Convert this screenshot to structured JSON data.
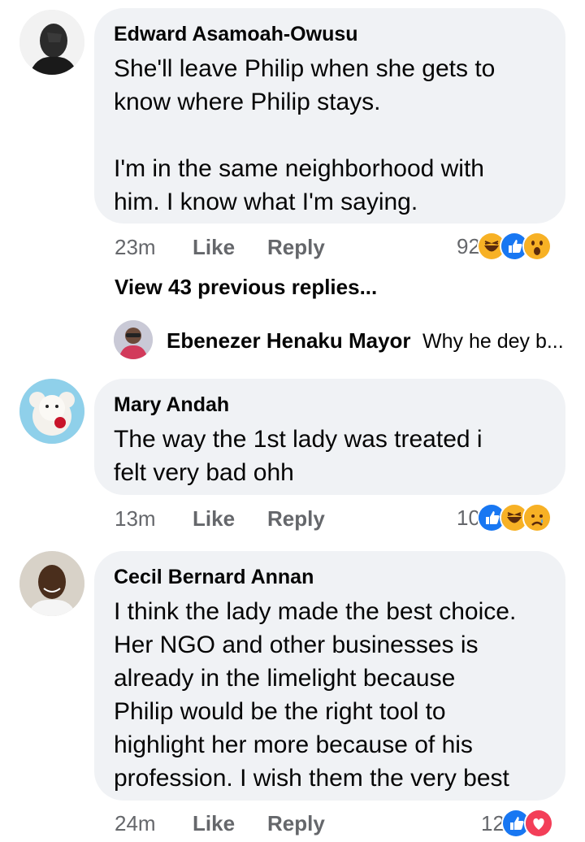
{
  "comments": [
    {
      "author": "Edward Asamoah-Owusu",
      "text": "She'll leave Philip when she gets to\nknow where Philip stays.\n\nI'm in the same neighborhood with\nhim. I know what I'm saying.",
      "time": "23m",
      "like_label": "Like",
      "reply_label": "Reply",
      "reaction_count": "92",
      "reactions": [
        "haha-icon",
        "like-icon",
        "wow-icon"
      ]
    },
    {
      "author": "Mary Andah",
      "text": "The way the 1st lady was treated i\nfelt very bad ohh",
      "time": "13m",
      "like_label": "Like",
      "reply_label": "Reply",
      "reaction_count": "10",
      "reactions": [
        "like-icon",
        "haha-icon",
        "sad-icon"
      ]
    },
    {
      "author": "Cecil Bernard Annan",
      "text": "I think the lady made the best choice.\nHer NGO and other businesses is\nalready in the limelight because\nPhilip would be the right tool to\nhighlight her more because of his\nprofession. I wish them the very best",
      "time": "24m",
      "like_label": "Like",
      "reply_label": "Reply",
      "reaction_count": "12",
      "reactions": [
        "like-icon",
        "love-icon"
      ]
    }
  ],
  "view_previous_replies": "View 43 previous replies...",
  "reply_preview": {
    "author": "Ebenezer Henaku Mayor",
    "snippet": "Why he dey b..."
  },
  "colors": {
    "bubble": "#f0f2f5",
    "meta": "#65676b",
    "like_blue": "#1877f2",
    "haha_yellow": "#f7b125",
    "love_red": "#f33e58"
  }
}
